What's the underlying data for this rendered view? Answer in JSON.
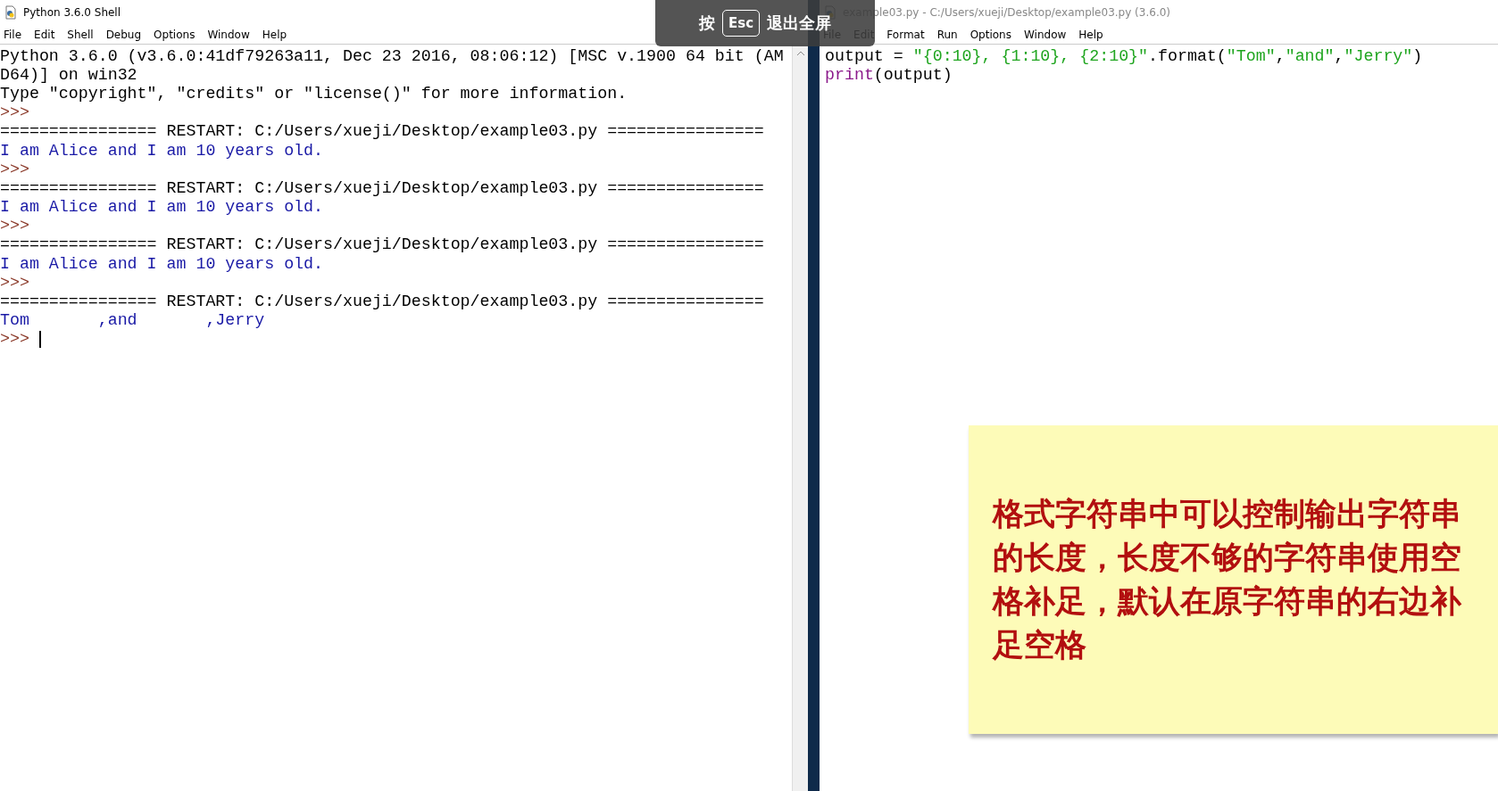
{
  "shell": {
    "title": "Python 3.6.0 Shell",
    "menu": [
      "File",
      "Edit",
      "Shell",
      "Debug",
      "Options",
      "Window",
      "Help"
    ],
    "lines": [
      {
        "kind": "plain",
        "text": "Python 3.6.0 (v3.6.0:41df79263a11, Dec 23 2016, 08:06:12) [MSC v.1900 64 bit (AM"
      },
      {
        "kind": "plain",
        "text": "D64)] on win32"
      },
      {
        "kind": "plain",
        "text": "Type \"copyright\", \"credits\" or \"license()\" for more information."
      },
      {
        "kind": "prompt",
        "text": ">>>"
      },
      {
        "kind": "plain",
        "text": "================ RESTART: C:/Users/xueji/Desktop/example03.py ================"
      },
      {
        "kind": "stdout",
        "text": "I am Alice and I am 10 years old."
      },
      {
        "kind": "prompt",
        "text": ">>>"
      },
      {
        "kind": "plain",
        "text": "================ RESTART: C:/Users/xueji/Desktop/example03.py ================"
      },
      {
        "kind": "stdout",
        "text": "I am Alice and I am 10 years old."
      },
      {
        "kind": "prompt",
        "text": ">>>"
      },
      {
        "kind": "plain",
        "text": "================ RESTART: C:/Users/xueji/Desktop/example03.py ================"
      },
      {
        "kind": "stdout",
        "text": "I am Alice and I am 10 years old."
      },
      {
        "kind": "prompt",
        "text": ">>>"
      },
      {
        "kind": "plain",
        "text": "================ RESTART: C:/Users/xueji/Desktop/example03.py ================"
      },
      {
        "kind": "stdout",
        "text": "Tom       ,and       ,Jerry"
      },
      {
        "kind": "input",
        "text": ">>>"
      }
    ]
  },
  "editor": {
    "title": "example03.py - C:/Users/xueji/Desktop/example03.py (3.6.0)",
    "menu": [
      "File",
      "Edit",
      "Format",
      "Run",
      "Options",
      "Window",
      "Help"
    ],
    "code": [
      [
        {
          "kind": "plain",
          "text": "output = "
        },
        {
          "kind": "string",
          "text": "\"{0:10}, {1:10}, {2:10}\""
        },
        {
          "kind": "plain",
          "text": ".format("
        },
        {
          "kind": "string",
          "text": "\"Tom\""
        },
        {
          "kind": "plain",
          "text": ","
        },
        {
          "kind": "string",
          "text": "\"and\""
        },
        {
          "kind": "plain",
          "text": ","
        },
        {
          "kind": "string",
          "text": "\"Jerry\""
        },
        {
          "kind": "plain",
          "text": ")"
        }
      ],
      [
        {
          "kind": "builtin",
          "text": "print"
        },
        {
          "kind": "plain",
          "text": "(output)"
        }
      ]
    ]
  },
  "fullscreen_hint": {
    "prefix": "按",
    "key": "Esc",
    "suffix": "退出全屏"
  },
  "note": {
    "text": "格式字符串中可以控制输出字符串的长度，长度不够的字符串使用空格补足，默认在原字符串的右边补足空格"
  }
}
